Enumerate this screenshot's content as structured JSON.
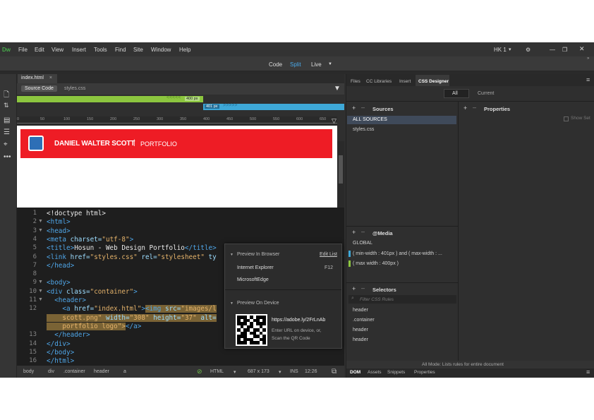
{
  "app": {
    "logo": "Dw",
    "menu": [
      "File",
      "Edit",
      "View",
      "Insert",
      "Tools",
      "Find",
      "Site",
      "Window",
      "Help"
    ],
    "workspace": "HK 1",
    "workspace_caret": "▾"
  },
  "viewmodes": {
    "code": "Code",
    "split": "Split",
    "live": "Live"
  },
  "document": {
    "tab": "index.html",
    "close": "×",
    "source_tabs": [
      "Source Code",
      "styles.css"
    ]
  },
  "media_queries": {
    "bar1_label": "400 px",
    "bar2_label": "401 px"
  },
  "ruler": [
    "0",
    "50",
    "100",
    "150",
    "200",
    "250",
    "300",
    "350",
    "400",
    "450",
    "500",
    "550",
    "600",
    "650"
  ],
  "live_banner": {
    "name": "DANIEL WALTER SCOTT",
    "sep": "|",
    "portfolio": "PORTFOLIO"
  },
  "code_lines": [
    {
      "n": "1",
      "fold": "",
      "parts": [
        {
          "c": "tx",
          "t": "<!doctype html>"
        }
      ]
    },
    {
      "n": "2",
      "fold": "▼",
      "parts": [
        {
          "c": "tg",
          "t": "<html>"
        }
      ]
    },
    {
      "n": "3",
      "fold": "▼",
      "parts": [
        {
          "c": "tg",
          "t": "<head>"
        }
      ]
    },
    {
      "n": "4",
      "fold": "",
      "parts": [
        {
          "c": "tg",
          "t": "<meta "
        },
        {
          "c": "at",
          "t": "charset="
        },
        {
          "c": "st",
          "t": "\"utf-8\""
        },
        {
          "c": "tg",
          "t": ">"
        }
      ]
    },
    {
      "n": "5",
      "fold": "",
      "parts": [
        {
          "c": "tg",
          "t": "<title>"
        },
        {
          "c": "tx",
          "t": "Hosun - Web Design Portfolio"
        },
        {
          "c": "tg",
          "t": "</title>"
        }
      ]
    },
    {
      "n": "6",
      "fold": "",
      "parts": [
        {
          "c": "tg",
          "t": "<link "
        },
        {
          "c": "at",
          "t": "href="
        },
        {
          "c": "st",
          "t": "\"styles.css\""
        },
        {
          "c": "at",
          "t": " rel="
        },
        {
          "c": "st",
          "t": "\"stylesheet\""
        },
        {
          "c": "at",
          "t": " ty"
        }
      ]
    },
    {
      "n": "7",
      "fold": "",
      "parts": [
        {
          "c": "tg",
          "t": "</head>"
        }
      ]
    },
    {
      "n": "8",
      "fold": "",
      "parts": []
    },
    {
      "n": "9",
      "fold": "▼",
      "parts": [
        {
          "c": "tg",
          "t": "<body>"
        }
      ]
    },
    {
      "n": "10",
      "fold": "▼",
      "parts": [
        {
          "c": "tg",
          "t": "<div "
        },
        {
          "c": "at",
          "t": "class="
        },
        {
          "c": "st",
          "t": "\"container\""
        },
        {
          "c": "tg",
          "t": ">"
        }
      ]
    },
    {
      "n": "11",
      "fold": "▼",
      "parts": [
        {
          "c": "tx",
          "t": "  "
        },
        {
          "c": "tg",
          "t": "<header>"
        }
      ]
    },
    {
      "n": "12",
      "fold": "",
      "parts": [
        {
          "c": "tx",
          "t": "    "
        },
        {
          "c": "tg",
          "t": "<a "
        },
        {
          "c": "at",
          "t": "href="
        },
        {
          "c": "st",
          "t": "\"index.html\""
        },
        {
          "c": "tg",
          "t": ">"
        },
        {
          "c": "tg hl",
          "t": "<img "
        },
        {
          "c": "at hl",
          "t": "src="
        },
        {
          "c": "st hl",
          "t": "\"images/l"
        }
      ]
    },
    {
      "n": "",
      "fold": "",
      "parts": [
        {
          "c": "st hl",
          "t": "    scott.png\""
        },
        {
          "c": "at hl",
          "t": " width="
        },
        {
          "c": "st hl",
          "t": "\"308\""
        },
        {
          "c": "at hl",
          "t": " height="
        },
        {
          "c": "st hl",
          "t": "\"37\""
        },
        {
          "c": "at hl",
          "t": " alt="
        }
      ]
    },
    {
      "n": "",
      "fold": "",
      "parts": [
        {
          "c": "st hl",
          "t": "    portfolio logo\">"
        },
        {
          "c": "tg",
          "t": "</a>"
        }
      ]
    },
    {
      "n": "13",
      "fold": "",
      "parts": [
        {
          "c": "tx",
          "t": "  "
        },
        {
          "c": "tg",
          "t": "</header>"
        }
      ]
    },
    {
      "n": "14",
      "fold": "",
      "parts": [
        {
          "c": "tg",
          "t": "</div>"
        }
      ]
    },
    {
      "n": "15",
      "fold": "",
      "parts": [
        {
          "c": "tg",
          "t": "</body>"
        }
      ]
    },
    {
      "n": "16",
      "fold": "",
      "parts": [
        {
          "c": "tg",
          "t": "</html>"
        }
      ]
    }
  ],
  "status": {
    "crumbs": [
      "body",
      "div",
      ".container",
      "header",
      "a"
    ],
    "mode": "HTML",
    "size": "687 x 173",
    "ins": "INS",
    "pos": "12:26"
  },
  "popup": {
    "browser_head": "Preview In Browser",
    "edit_list": "Edit List",
    "ie": "Internet Explorer",
    "ie_key": "F12",
    "edge": "MicrosoftEdge",
    "device_head": "Preview On Device",
    "url": "https://adobe.ly/2FrLnAb",
    "hint1": "Enter URL on device, or,",
    "hint2": "Scan the QR Code"
  },
  "panels": {
    "tabs": [
      "Files",
      "CC Libraries",
      "Insert",
      "CSS Designer"
    ],
    "all": "All",
    "current": "Current",
    "sources": "Sources",
    "all_sources": "ALL SOURCES",
    "styles": "styles.css",
    "properties": "Properties",
    "show_set": "Show Set",
    "media": "@Media",
    "global": "GLOBAL",
    "mq_a": "( min-width : 401px ) and ( max-width : ...",
    "mq_b": "( max width : 400px )",
    "selectors": "Selectors",
    "filter": "Filter CSS Rules",
    "sel": [
      "header",
      ".container",
      "header",
      "header"
    ],
    "all_mode": "All Mode: Lists rules for entire document",
    "bottom_tabs": [
      "DOM",
      "Assets",
      "Snippets",
      "Properties"
    ]
  }
}
